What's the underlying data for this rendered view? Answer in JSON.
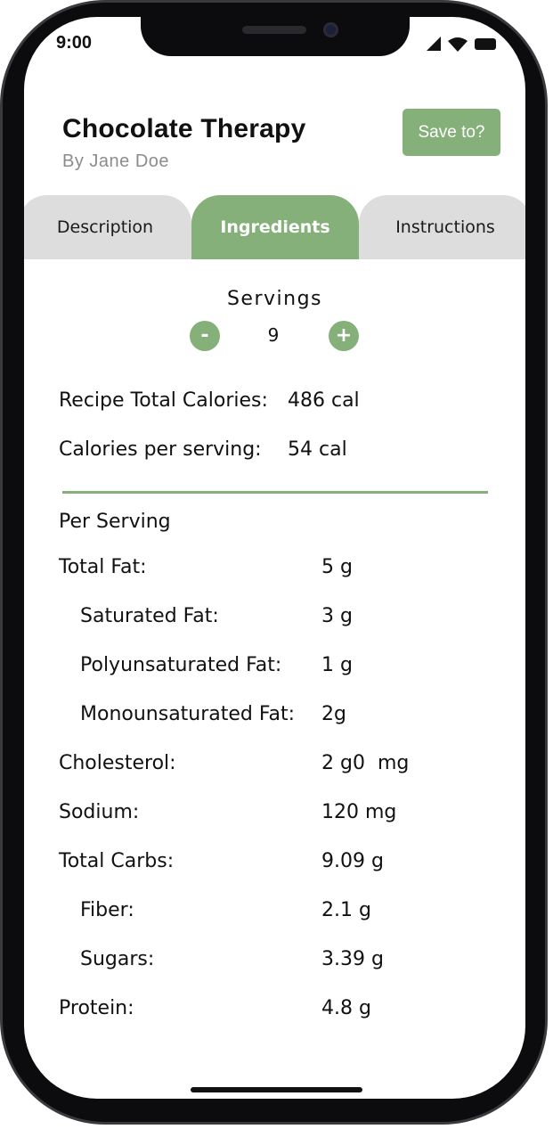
{
  "status_bar": {
    "time": "9:00",
    "icons": [
      "signal-icon",
      "wifi-icon",
      "battery-icon"
    ]
  },
  "recipe": {
    "title": "Chocolate Therapy",
    "author": "By Jane Doe"
  },
  "header": {
    "save_label": "Save to?"
  },
  "tabs": [
    {
      "label": "Description",
      "active": false
    },
    {
      "label": "Ingredients",
      "active": true
    },
    {
      "label": "Instructions",
      "active": false
    }
  ],
  "servings": {
    "label": "Servings",
    "value": "9",
    "decrement": "-",
    "increment": "+"
  },
  "summary": [
    {
      "label": "Recipe Total Calories:",
      "value": "486 cal"
    },
    {
      "label": "Calories per serving:",
      "value": "54 cal"
    }
  ],
  "nutrition": {
    "heading": "Per Serving",
    "rows": [
      {
        "label": "Total Fat:",
        "value": "5 g",
        "sub": false
      },
      {
        "label": "Saturated Fat:",
        "value": "3 g",
        "sub": true
      },
      {
        "label": "Polyunsaturated Fat:",
        "value": "1 g",
        "sub": true
      },
      {
        "label": "Monounsaturated Fat:",
        "value": "2g",
        "sub": true
      },
      {
        "label": "Cholesterol:",
        "value": "2 g0  mg",
        "sub": false
      },
      {
        "label": "Sodium:",
        "value": "120 mg",
        "sub": false
      },
      {
        "label": "Total Carbs:",
        "value": "9.09 g",
        "sub": false
      },
      {
        "label": "Fiber:",
        "value": "2.1 g",
        "sub": true
      },
      {
        "label": "Sugars:",
        "value": "3.39 g",
        "sub": true
      },
      {
        "label": "Protein:",
        "value": "4.8 g",
        "sub": false
      }
    ]
  },
  "colors": {
    "accent": "#86b07a",
    "tab_inactive": "#dddddd",
    "muted_text": "#8c8c8c"
  }
}
